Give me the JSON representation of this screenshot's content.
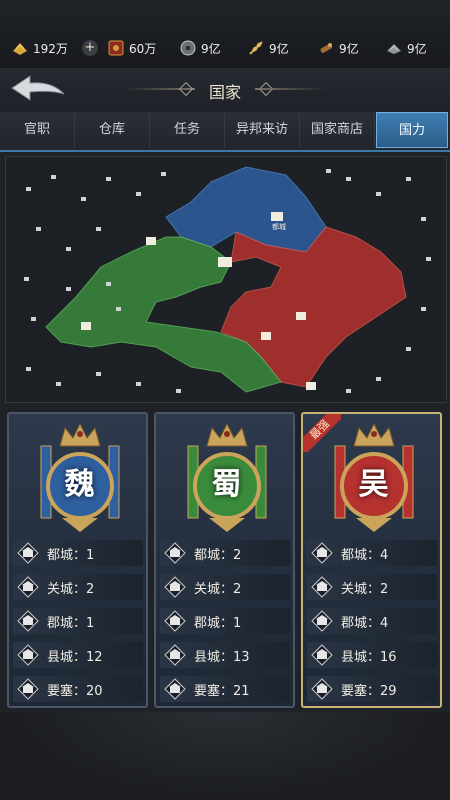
{
  "resources": [
    {
      "icon": "gold-icon",
      "value": "192万"
    },
    {
      "icon": "token-icon",
      "value": "60万"
    },
    {
      "icon": "coin-icon",
      "value": "9亿"
    },
    {
      "icon": "grain-icon",
      "value": "9亿"
    },
    {
      "icon": "wood-icon",
      "value": "9亿"
    },
    {
      "icon": "iron-icon",
      "value": "9亿"
    }
  ],
  "header": {
    "title": "国家"
  },
  "tabs": [
    {
      "label": "官职"
    },
    {
      "label": "仓库"
    },
    {
      "label": "任务"
    },
    {
      "label": "异邦来访"
    },
    {
      "label": "国家商店"
    },
    {
      "label": "国力",
      "active": true
    }
  ],
  "map_labels": {
    "capital": "都城"
  },
  "colors": {
    "wei": "#2e5f9e",
    "shu": "#3a8a3c",
    "wu": "#b5322f",
    "accent": "#3a78a8"
  },
  "factions": [
    {
      "name": "魏",
      "ribbon": "",
      "stats": [
        {
          "label": "都城：1"
        },
        {
          "label": "关城：2"
        },
        {
          "label": "郡城：1"
        },
        {
          "label": "县城：12"
        },
        {
          "label": "要塞：20"
        }
      ]
    },
    {
      "name": "蜀",
      "ribbon": "",
      "stats": [
        {
          "label": "都城：2"
        },
        {
          "label": "关城：2"
        },
        {
          "label": "郡城：1"
        },
        {
          "label": "县城：13"
        },
        {
          "label": "要塞：21"
        }
      ]
    },
    {
      "name": "吴",
      "ribbon": "最强",
      "stats": [
        {
          "label": "都城：4"
        },
        {
          "label": "关城：2"
        },
        {
          "label": "郡城：4"
        },
        {
          "label": "县城：16"
        },
        {
          "label": "要塞：29"
        }
      ]
    }
  ]
}
